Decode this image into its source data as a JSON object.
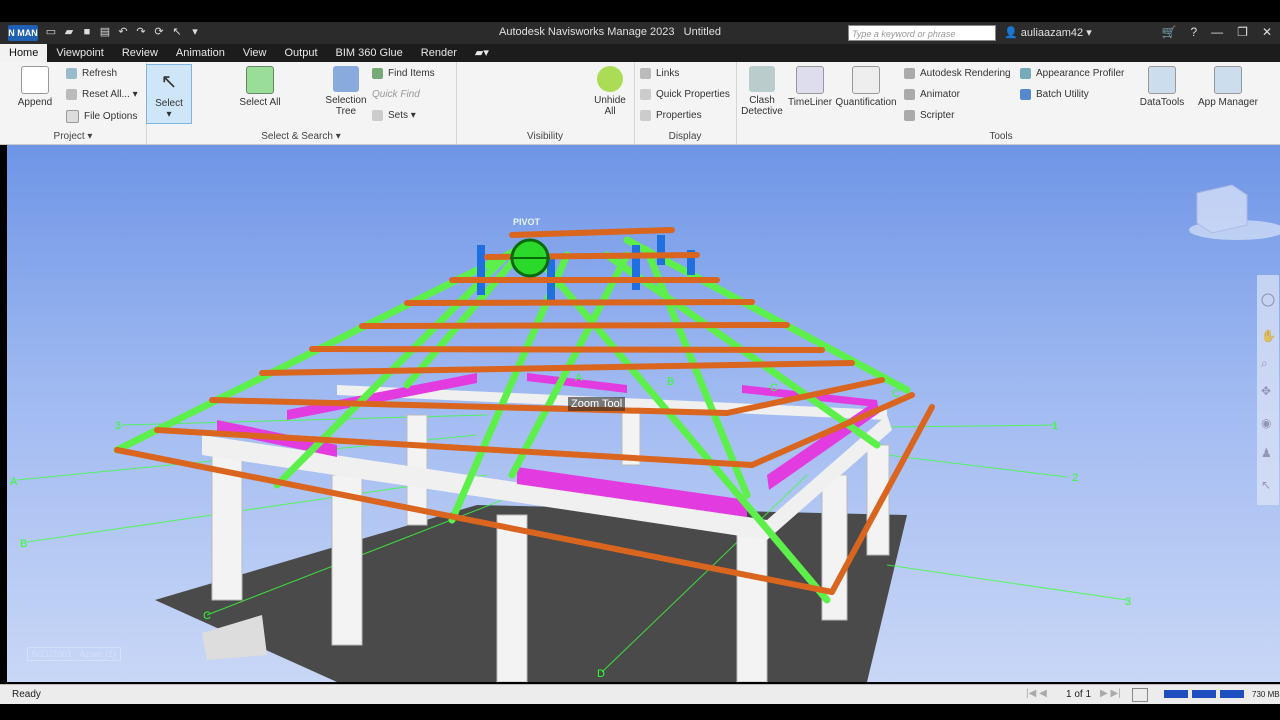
{
  "app": {
    "logo": "N MAN",
    "title": "Autodesk Navisworks Manage 2023",
    "doc": "Untitled",
    "search_placeholder": "Type a keyword or phrase",
    "user": "auliaazam42"
  },
  "tabs": [
    "Home",
    "Viewpoint",
    "Review",
    "Animation",
    "View",
    "Output",
    "BIM 360 Glue",
    "Render"
  ],
  "ribbon": {
    "project": {
      "label": "Project",
      "append": "Append",
      "refresh": "Refresh",
      "reset_all": "Reset All...",
      "file_options": "File Options"
    },
    "select_search": {
      "label": "Select & Search",
      "select": "Select",
      "select_all": "Select All",
      "selection_tree": "Selection Tree",
      "find_items": "Find Items",
      "quick_find": "Quick Find",
      "sets": "Sets"
    },
    "visibility": {
      "label": "Visibility",
      "unhide_all": "Unhide All"
    },
    "display": {
      "label": "Display",
      "links": "Links",
      "quick_properties": "Quick Properties",
      "properties": "Properties"
    },
    "tools": {
      "label": "Tools",
      "clash_detective": "Clash Detective",
      "timeliner": "TimeLiner",
      "quantification": "Quantification",
      "autodesk_rendering": "Autodesk Rendering",
      "animator": "Animator",
      "scripter": "Scripter",
      "appearance_profiler": "Appearance Profiler",
      "batch_utility": "Batch Utility",
      "datatools": "DataTools",
      "app_manager": "App Manager"
    }
  },
  "viewport": {
    "pivot_label": "PIVOT",
    "tooltip": "Zoom Tool",
    "watermark": "5/21/2001 · Azam (1)",
    "grid_labels": {
      "g1": "1",
      "g2": "2",
      "g3": "3",
      "g3b": "3",
      "ga": "A",
      "gb": "B",
      "gc": "C",
      "gd": "D",
      "ga2": "A",
      "gb2": "B",
      "gc2": "C",
      "gc3": "C"
    }
  },
  "status": {
    "ready": "Ready",
    "page": "1 of 1",
    "memory": "730 MB"
  },
  "colors": {
    "sky_top": "#6e95e6",
    "orange": "#d9651e",
    "green": "#5ef04a",
    "magenta": "#e23ce0",
    "blue": "#1f6fe0",
    "floor": "#4a4a4a"
  }
}
